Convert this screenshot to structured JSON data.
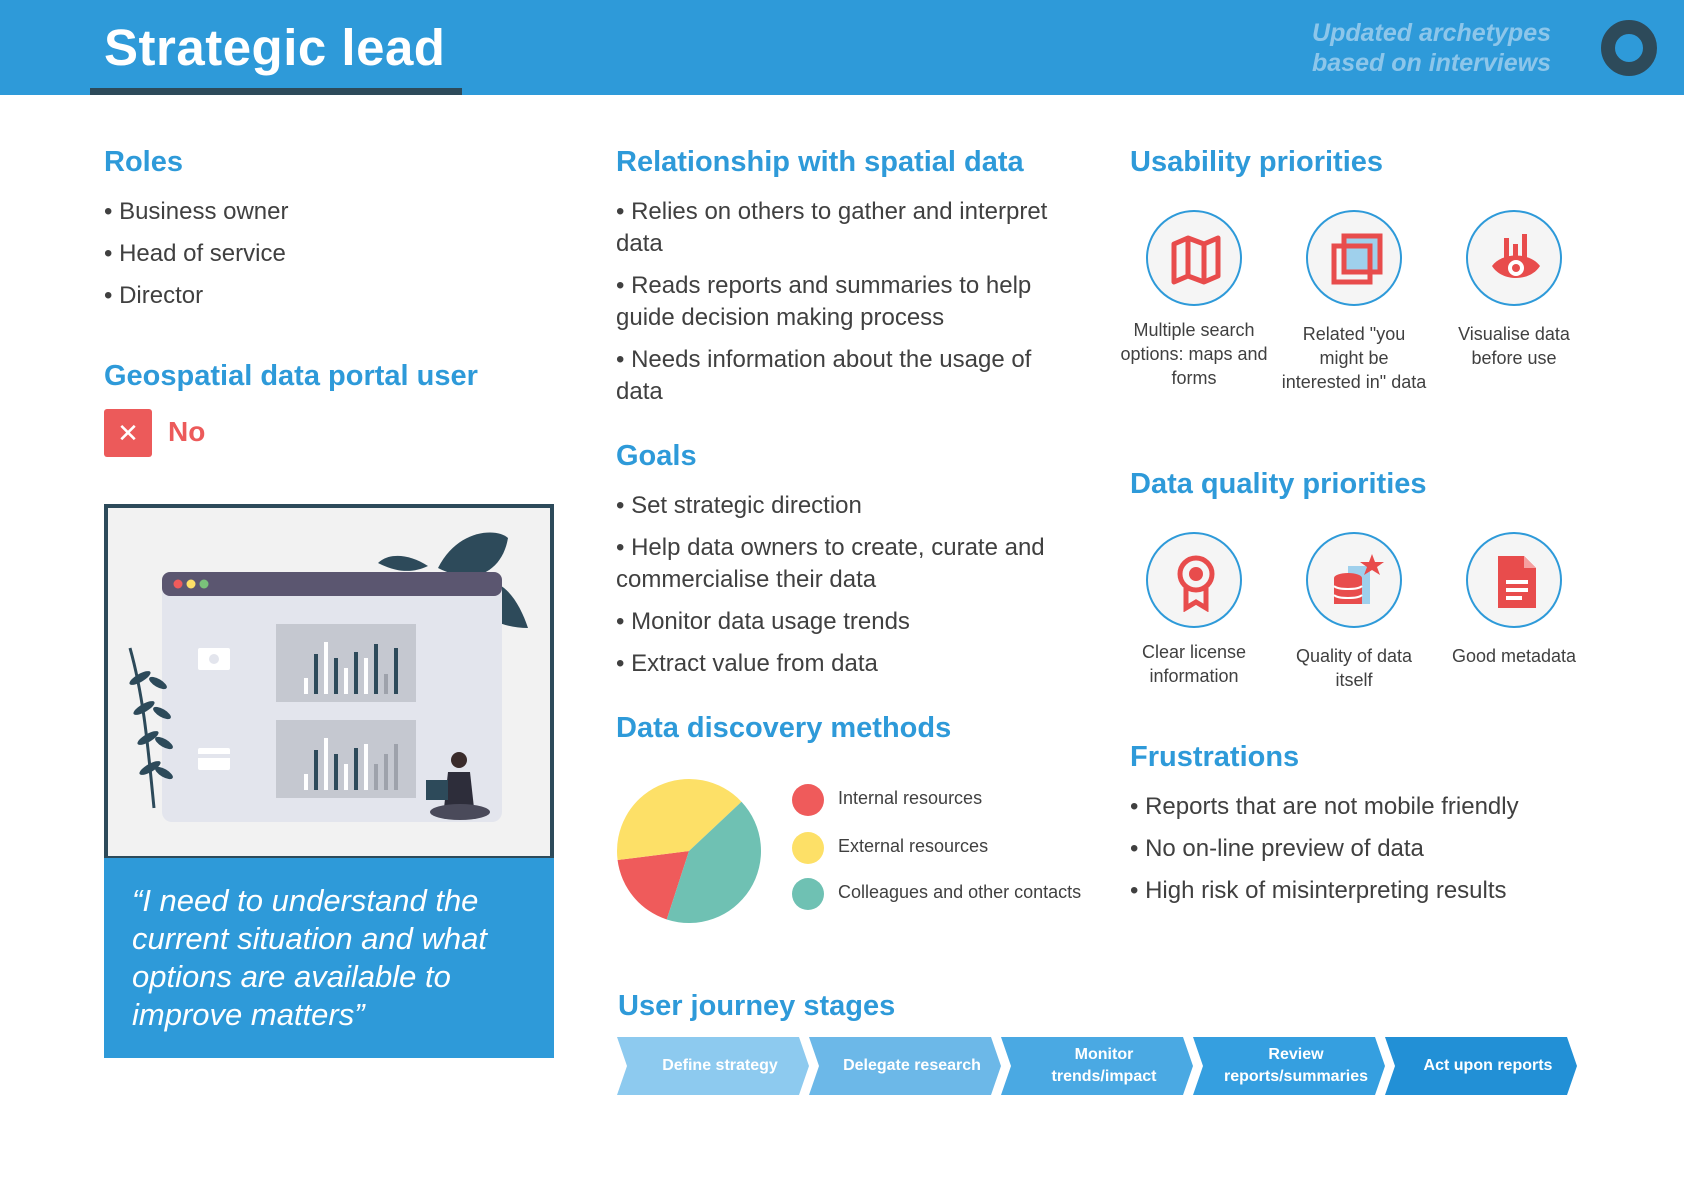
{
  "header": {
    "title": "Strategic lead",
    "note_line1": "Updated archetypes",
    "note_line2": "based on interviews"
  },
  "roles": {
    "heading": "Roles",
    "items": [
      "Business owner",
      "Head of service",
      "Director"
    ]
  },
  "portal_user": {
    "heading": "Geospatial data portal user",
    "icon": "close-icon",
    "icon_glyph": "✕",
    "value": "No"
  },
  "quote": "“I need to understand the current situation and what options are available to improve matters”",
  "relationship": {
    "heading": "Relationship with spatial data",
    "items": [
      "Relies on others to gather and interpret data",
      "Reads reports and summaries to help guide decision making process",
      "Needs information about the usage of data"
    ]
  },
  "goals": {
    "heading": "Goals",
    "items": [
      "Set strategic direction",
      "Help data owners to create, curate and commercialise their data",
      "Monitor data usage trends",
      "Extract value from data"
    ]
  },
  "chart_data": {
    "type": "pie",
    "title": "Data discovery methods",
    "categories": [
      "Internal resources",
      "External resources",
      "Colleagues and other contacts"
    ],
    "values": [
      18,
      40,
      42
    ],
    "colors": [
      "#ef5b5b",
      "#fde067",
      "#6fc1b3"
    ]
  },
  "usability": {
    "heading": "Usability priorities",
    "items": [
      {
        "icon": "map-icon",
        "label": "Multiple search options: maps and forms"
      },
      {
        "icon": "related-items-icon",
        "label": "Related \"you might be interested in\" data"
      },
      {
        "icon": "visualise-eye-icon",
        "label": "Visualise data before use"
      }
    ]
  },
  "quality": {
    "heading": "Data quality priorities",
    "items": [
      {
        "icon": "award-icon",
        "label": "Clear license information"
      },
      {
        "icon": "database-star-icon",
        "label": "Quality of data itself"
      },
      {
        "icon": "document-icon",
        "label": "Good metadata"
      }
    ]
  },
  "frustrations": {
    "heading": "Frustrations",
    "items": [
      "Reports that are not mobile friendly",
      "No on-line preview of data",
      "High risk of misinterpreting results"
    ]
  },
  "journey": {
    "heading": "User journey stages",
    "stages": [
      {
        "label": "Define strategy",
        "color": "#8dcaef"
      },
      {
        "label": "Delegate research",
        "color": "#6cb8e8"
      },
      {
        "label": "Monitor trends/impact",
        "color": "#4aa9e3"
      },
      {
        "label": "Review reports/summaries",
        "color": "#359fe0"
      },
      {
        "label": "Act upon reports",
        "color": "#2290d6"
      }
    ]
  },
  "colors": {
    "brand_blue": "#2e9ad9",
    "dark": "#2d4a5a",
    "alert_red": "#ec5a5a"
  }
}
